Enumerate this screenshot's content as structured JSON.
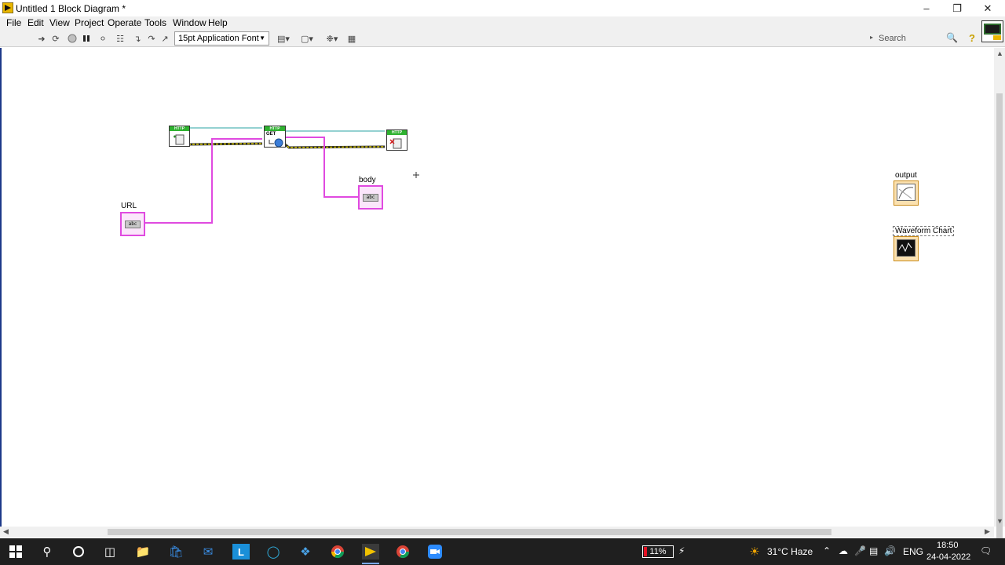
{
  "window": {
    "title": "Untitled 1 Block Diagram *"
  },
  "menu": [
    "File",
    "Edit",
    "View",
    "Project",
    "Operate",
    "Tools",
    "Window",
    "Help"
  ],
  "toolbar": {
    "font_select": "15pt Application Font",
    "search_placeholder": "Search",
    "icons": [
      "run-arrow-icon",
      "run-continuously-icon",
      "abort-icon",
      "pause-icon",
      "highlight-execution-icon",
      "retain-wire-values-icon",
      "step-into-icon",
      "step-over-icon",
      "step-out-icon",
      "align-objects-icon",
      "distribute-objects-icon",
      "reorder-icon",
      "cleanup-diagram-icon",
      "help-icon"
    ]
  },
  "diagram": {
    "nodes": [
      {
        "name": "http-open-handle",
        "tag": "HTTP"
      },
      {
        "name": "http-get",
        "tag": "HTTP",
        "sub": "GET"
      },
      {
        "name": "http-close-handle",
        "tag": "HTTP"
      }
    ],
    "labels": {
      "url": "URL",
      "body": "body",
      "output": "output",
      "waveform_chart": "Waveform Chart"
    },
    "string_glyph": "abc",
    "colors": {
      "string_wire": "#e04ae0",
      "refnum_wire": "#2aa3a3",
      "error_wire": "#d4c200",
      "http_tag": "#2fb230"
    }
  },
  "taskbar": {
    "battery": "11%",
    "weather": "31°C  Haze",
    "language": "ENG",
    "time": "18:50",
    "date": "24-04-2022",
    "apps": [
      "windows-start-icon",
      "search-icon",
      "cortana-icon",
      "task-view-icon",
      "file-explorer-icon",
      "store-icon",
      "mail-icon",
      "labview-l-icon",
      "edge-icon",
      "vscode-icon",
      "chrome-icon",
      "labview-icon",
      "chrome-profile-icon",
      "zoom-icon"
    ]
  }
}
